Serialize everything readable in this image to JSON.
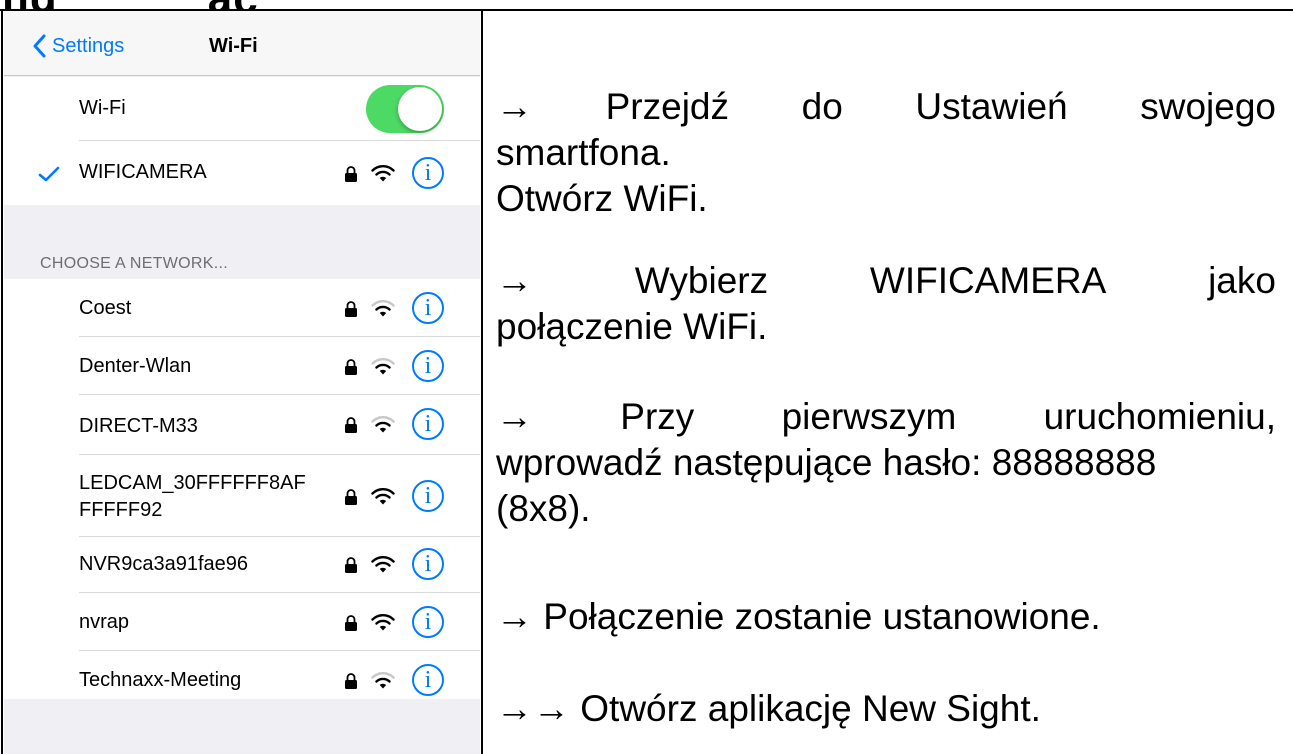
{
  "heading": {
    "left_text": "ng",
    "right_text": "ąc"
  },
  "phone": {
    "nav": {
      "back_label": "Settings",
      "title": "Wi-Fi"
    },
    "wifi_toggle": {
      "label": "Wi-Fi",
      "state": "on",
      "color": "#4cd964"
    },
    "connected": {
      "name": "WIFICAMERA"
    },
    "section_header": "CHOOSE A NETWORK...",
    "networks": [
      {
        "name": "Coest"
      },
      {
        "name": "Denter-Wlan"
      },
      {
        "name": "DIRECT-M33"
      },
      {
        "name_line1": "LEDCAM_30FFFFFF8AF",
        "name_line2": "FFFFF92"
      },
      {
        "name": "NVR9ca3a91fae96"
      },
      {
        "name": "nvrap"
      },
      {
        "name": "Technaxx-Meeting"
      }
    ],
    "accent_color": "#007aff",
    "icons": [
      "chevron-left-icon",
      "checkmark-icon",
      "lock-icon",
      "wifi-icon",
      "info-icon"
    ]
  },
  "instructions": {
    "step1": {
      "line1_words": [
        "→",
        "Przejdź",
        "do",
        "Ustawień",
        "swojego"
      ],
      "line2": "smartfona.",
      "line3": "Otwórz WiFi."
    },
    "step2": {
      "line1_words": [
        "→",
        "Wybierz",
        "WIFICAMERA",
        "jako"
      ],
      "line2": "połączenie WiFi."
    },
    "step3": {
      "line1_words": [
        "→",
        "Przy",
        "pierwszym",
        "uruchomieniu,"
      ],
      "line2": "wprowadź następujące hasło: 88888888",
      "line3": "(8x8)."
    },
    "step4": "→ Połączenie zostanie ustanowione.",
    "step5": "→→ Otwórz aplikację New Sight."
  }
}
